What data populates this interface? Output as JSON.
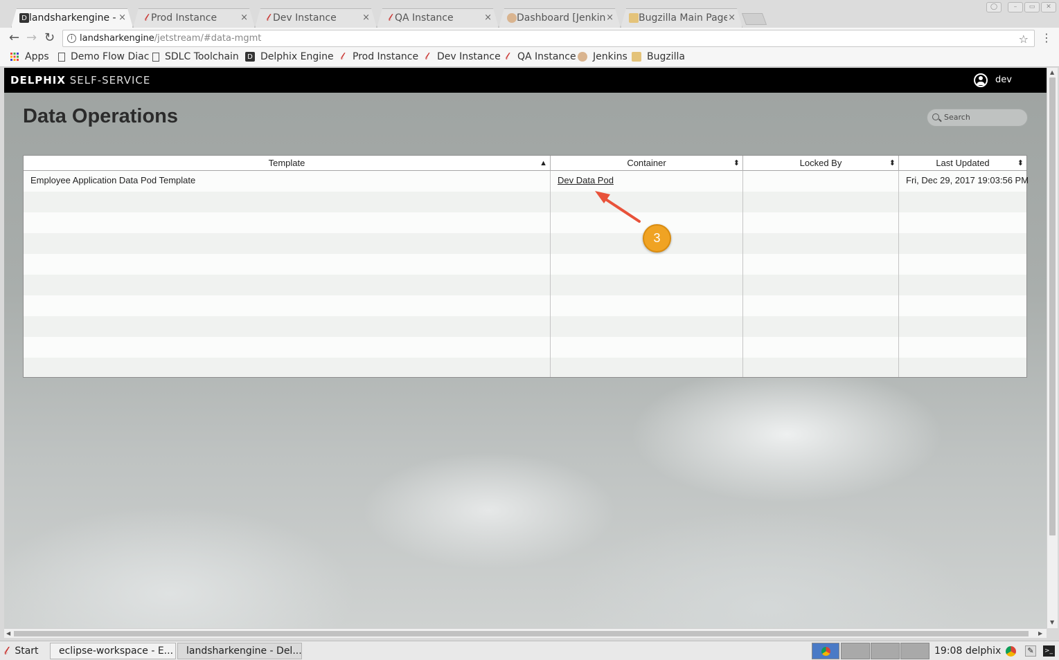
{
  "browser": {
    "tabs": [
      {
        "title": "landsharkengine -",
        "active": true,
        "icon": "delphix-d-icon"
      },
      {
        "title": "Prod Instance",
        "active": false,
        "icon": "jenkins-red-icon"
      },
      {
        "title": "Dev Instance",
        "active": false,
        "icon": "jenkins-red-icon"
      },
      {
        "title": "QA Instance",
        "active": false,
        "icon": "jenkins-red-icon"
      },
      {
        "title": "Dashboard [Jenkin",
        "active": false,
        "icon": "jenkins-butler-icon"
      },
      {
        "title": "Bugzilla Main Page",
        "active": false,
        "icon": "bugzilla-icon"
      }
    ],
    "close_glyph": "×",
    "url_host": "landsharkengine",
    "url_path": "/jetstream/#data-mgmt",
    "bookmarks": [
      {
        "label": "Apps",
        "icon": "apps-grid-icon"
      },
      {
        "label": "Demo Flow Diac",
        "icon": "page-icon"
      },
      {
        "label": "SDLC Toolchain",
        "icon": "page-icon"
      },
      {
        "label": "Delphix Engine",
        "icon": "delphix-d-icon"
      },
      {
        "label": "Prod Instance",
        "icon": "jenkins-red-icon"
      },
      {
        "label": "Dev Instance",
        "icon": "jenkins-red-icon"
      },
      {
        "label": "QA Instance",
        "icon": "jenkins-red-icon"
      },
      {
        "label": "Jenkins",
        "icon": "jenkins-butler-icon"
      },
      {
        "label": "Bugzilla",
        "icon": "bugzilla-icon"
      }
    ]
  },
  "app": {
    "brand_bold": "DELPHIX",
    "brand_light": "SELF-SERVICE",
    "user": "dev",
    "page_title": "Data Operations",
    "search_placeholder": "Search",
    "table": {
      "columns": [
        "Template",
        "Container",
        "Locked By",
        "Last Updated"
      ],
      "sort_indicators": [
        "▲",
        "⬍",
        "⬍",
        "⬍"
      ],
      "rows": [
        {
          "template": "Employee Application Data Pod Template",
          "container": "Dev Data Pod",
          "locked_by": "",
          "last_updated": "Fri, Dec 29, 2017 19:03:56 PM"
        }
      ]
    },
    "callout_step": "3",
    "callout_color": "#f0a323",
    "arrow_color": "#e8523a"
  },
  "taskbar": {
    "start": "Start",
    "tasks": [
      "eclipse-workspace - E...",
      "landsharkengine - Del..."
    ],
    "clock": "19:08",
    "user": "delphix"
  }
}
